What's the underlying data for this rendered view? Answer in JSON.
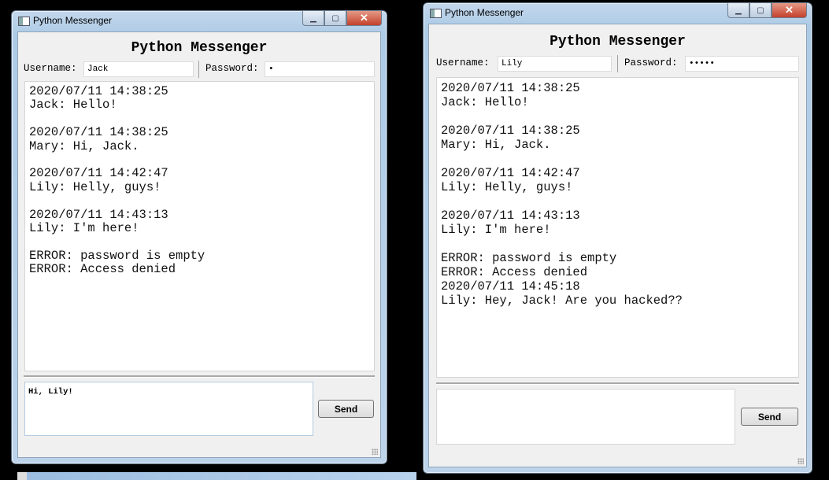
{
  "windows": [
    {
      "window_title": "Python Messenger",
      "heading": "Python Messenger",
      "username_label": "Username:",
      "username_value": "Jack",
      "password_label": "Password:",
      "password_value": "•",
      "chat_log": "2020/07/11 14:38:25\nJack: Hello!\n\n2020/07/11 14:38:25\nMary: Hi, Jack.\n\n2020/07/11 14:42:47\nLily: Helly, guys!\n\n2020/07/11 14:43:13\nLily: I'm here!\n\nERROR: password is empty\nERROR: Access denied",
      "message_input": "Hi, Lily!",
      "send_label": "Send"
    },
    {
      "window_title": "Python Messenger",
      "heading": "Python Messenger",
      "username_label": "Username:",
      "username_value": "Lily",
      "password_label": "Password:",
      "password_value": "•••••",
      "chat_log": "2020/07/11 14:38:25\nJack: Hello!\n\n2020/07/11 14:38:25\nMary: Hi, Jack.\n\n2020/07/11 14:42:47\nLily: Helly, guys!\n\n2020/07/11 14:43:13\nLily: I'm here!\n\nERROR: password is empty\nERROR: Access denied\n2020/07/11 14:45:18\nLily: Hey, Jack! Are you hacked??",
      "message_input": "",
      "send_label": "Send"
    }
  ]
}
